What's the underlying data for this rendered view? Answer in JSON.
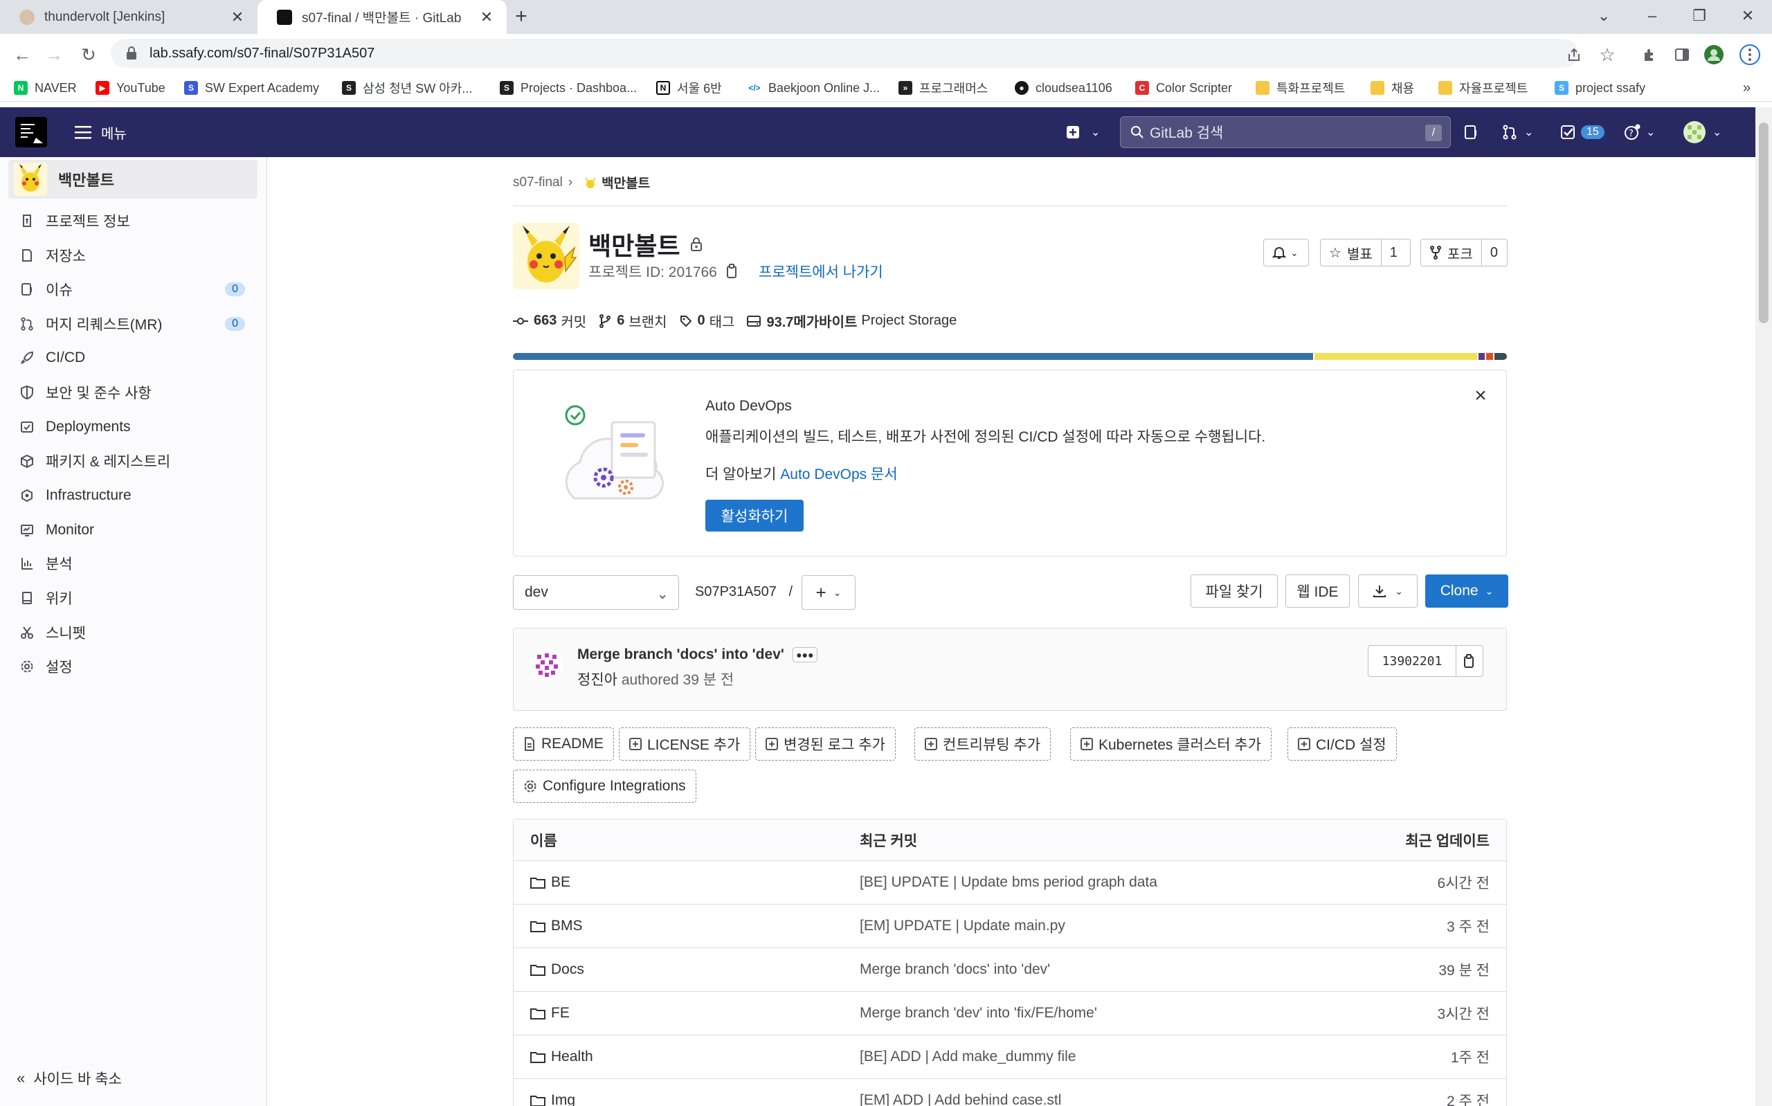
{
  "browser": {
    "tabs": [
      {
        "title": "thundervolt [Jenkins]",
        "active": false
      },
      {
        "title": "s07-final / 백만볼트 · GitLab",
        "active": true
      }
    ],
    "url": "lab.ssafy.com/s07-final/S07P31A507",
    "bookmarks": [
      {
        "label": "NAVER",
        "icon": "naver-icon",
        "color": "#03c75a"
      },
      {
        "label": "YouTube",
        "icon": "youtube-icon",
        "color": "#ff0000"
      },
      {
        "label": "SW Expert Academy",
        "icon": "swea-icon",
        "color": "#3b5bdb"
      },
      {
        "label": "삼성 청년 SW 아카...",
        "icon": "ssafy-icon",
        "color": "#222222"
      },
      {
        "label": "Projects · Dashboa...",
        "icon": "gitlab-icon",
        "color": "#222222"
      },
      {
        "label": "서울 6반",
        "icon": "notion-icon",
        "color": "#000000"
      },
      {
        "label": "Baekjoon Online J...",
        "icon": "baekjoon-icon",
        "color": "#0076c0"
      },
      {
        "label": "프로그래머스",
        "icon": "programmers-icon",
        "color": "#222222"
      },
      {
        "label": "cloudsea1106",
        "icon": "github-icon",
        "color": "#181717"
      },
      {
        "label": "Color Scripter",
        "icon": "colorscripter-icon",
        "color": "#e03131"
      },
      {
        "label": "특화프로젝트",
        "icon": "folder-icon",
        "color": "#f6c744"
      },
      {
        "label": "채용",
        "icon": "folder-icon",
        "color": "#f6c744"
      },
      {
        "label": "자율프로젝트",
        "icon": "folder-icon",
        "color": "#f6c744"
      },
      {
        "label": "project ssafy",
        "icon": "ssafy-icon",
        "color": "#4dabf7"
      }
    ]
  },
  "gitlab": {
    "menu_label": "메뉴",
    "search_placeholder": "GitLab 검색",
    "search_shortcut": "/",
    "todo_count": "15"
  },
  "sidebar": {
    "project_name": "백만볼트",
    "items": [
      {
        "label": "프로젝트 정보",
        "icon": "info-icon"
      },
      {
        "label": "저장소",
        "icon": "doc-icon"
      },
      {
        "label": "이슈",
        "icon": "issues-icon",
        "count": "0"
      },
      {
        "label": "머지 리퀘스트(MR)",
        "icon": "merge-request-icon",
        "count": "0"
      },
      {
        "label": "CI/CD",
        "icon": "rocket-icon"
      },
      {
        "label": "보안 및 준수 사항",
        "icon": "shield-icon"
      },
      {
        "label": "Deployments",
        "icon": "deployments-icon"
      },
      {
        "label": "패키지 & 레지스트리",
        "icon": "package-icon"
      },
      {
        "label": "Infrastructure",
        "icon": "infrastructure-icon"
      },
      {
        "label": "Monitor",
        "icon": "monitor-icon"
      },
      {
        "label": "분석",
        "icon": "analytics-icon"
      },
      {
        "label": "위키",
        "icon": "wiki-icon"
      },
      {
        "label": "스니펫",
        "icon": "snippet-icon"
      },
      {
        "label": "설정",
        "icon": "settings-icon"
      }
    ],
    "collapse_label": "사이드 바 축소"
  },
  "project": {
    "breadcrumb_group": "s07-final",
    "breadcrumb_project": "백만볼트",
    "title": "백만볼트",
    "id_label": "프로젝트 ID: 201766",
    "leave_label": "프로젝트에서 나가기",
    "star_label": "별표",
    "star_count": "1",
    "fork_label": "포크",
    "fork_count": "0",
    "stats": {
      "commits_value": "663",
      "commits_label": "커밋",
      "branches_value": "6",
      "branches_label": "브랜치",
      "tags_value": "0",
      "tags_label": "태그",
      "storage_value": "93.7메가바이트",
      "storage_label": "Project Storage"
    },
    "languages": [
      {
        "color": "#3572a5",
        "share": 0.805
      },
      {
        "color": "#f1e05a",
        "share": 0.165
      },
      {
        "color": "#563d7c",
        "share": 0.008
      },
      {
        "color": "#e34c26",
        "share": 0.008
      },
      {
        "color": "#384d54",
        "share": 0.014
      }
    ]
  },
  "devops": {
    "title": "Auto DevOps",
    "description": "애플리케이션의 빌드, 테스트, 배포가 사전에 정의된 CI/CD 설정에 따라 자동으로 수행됩니다.",
    "more_prefix": "더 알아보기",
    "more_link": "Auto DevOps 문서",
    "enable_button": "활성화하기"
  },
  "repo": {
    "branch": "dev",
    "path": "S07P31A507",
    "path_sep": "/",
    "find_file": "파일 찾기",
    "web_ide": "웹 IDE",
    "clone": "Clone"
  },
  "last_commit": {
    "message": "Merge branch 'docs' into 'dev'",
    "author": "정진아",
    "authored": "authored 39 분 전",
    "sha": "13902201"
  },
  "quick_actions": [
    {
      "label": "README",
      "icon": "doc-icon"
    },
    {
      "label": "LICENSE 추가",
      "icon": "plus-square-icon"
    },
    {
      "label": "변경된 로그 추가",
      "icon": "plus-square-icon"
    },
    {
      "label": "컨트리뷰팅 추가",
      "icon": "plus-square-icon"
    },
    {
      "label": "Kubernetes 클러스터 추가",
      "icon": "plus-square-icon"
    },
    {
      "label": "CI/CD 설정",
      "icon": "plus-square-icon"
    },
    {
      "label": "Configure Integrations",
      "icon": "settings-icon"
    }
  ],
  "files": {
    "headers": {
      "name": "이름",
      "commit": "최근 커밋",
      "updated": "최근 업데이트"
    },
    "rows": [
      {
        "name": "BE",
        "commit": "[BE] UPDATE | Update bms period graph data",
        "updated": "6시간 전"
      },
      {
        "name": "BMS",
        "commit": "[EM] UPDATE | Update main.py",
        "updated": "3 주 전"
      },
      {
        "name": "Docs",
        "commit": "Merge branch 'docs' into 'dev'",
        "updated": "39 분 전"
      },
      {
        "name": "FE",
        "commit": "Merge branch 'dev' into 'fix/FE/home'",
        "updated": "3시간 전"
      },
      {
        "name": "Health",
        "commit": "[BE] ADD | Add make_dummy file",
        "updated": "1주 전"
      },
      {
        "name": "Img",
        "commit": "[EM] ADD | Add behind case.stl",
        "updated": "2 주 전"
      }
    ]
  }
}
